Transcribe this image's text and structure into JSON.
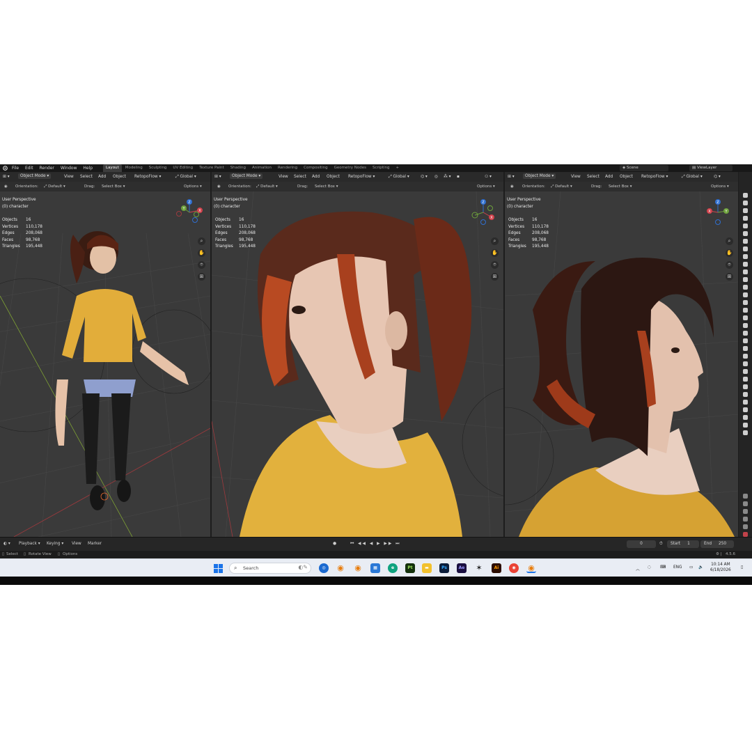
{
  "menu": [
    "File",
    "Edit",
    "Render",
    "Window",
    "Help"
  ],
  "workspace_tabs": [
    "Layout",
    "Modeling",
    "Sculpting",
    "UV Editing",
    "Texture Paint",
    "Shading",
    "Animation",
    "Rendering",
    "Compositing",
    "Geometry Nodes",
    "Scripting"
  ],
  "active_tab": "Layout",
  "scene": {
    "scene_label": "Scene",
    "view_layer_label": "ViewLayer"
  },
  "viewport_header": {
    "mode": "Object Mode",
    "menus": [
      "View",
      "Select",
      "Add",
      "Object"
    ],
    "addon": "RetopoFlow",
    "transform_orientation": "Global",
    "orientation_label": "Orientation:",
    "orientation_value": "Default",
    "drag_label": "Drag:",
    "drag_value": "Select Box",
    "options": "Options"
  },
  "viewport_info": {
    "perspective": "User Perspective",
    "collection": "(0) character",
    "stats": [
      {
        "label": "Objects",
        "value": "16"
      },
      {
        "label": "Vertices",
        "value": "110,178"
      },
      {
        "label": "Edges",
        "value": "208,068"
      },
      {
        "label": "Faces",
        "value": "98,768"
      },
      {
        "label": "Triangles",
        "value": "195,448"
      }
    ]
  },
  "gizmo_axes": {
    "x": "X",
    "y": "Y",
    "z": "Z"
  },
  "timeline": {
    "menus": [
      "Playback",
      "Keying",
      "View",
      "Marker"
    ],
    "current_frame": "0",
    "start_label": "Start",
    "start_value": "1",
    "end_label": "End",
    "end_value": "250"
  },
  "statusbar": {
    "select": "Select",
    "rotate": "Rotate View",
    "options": "Options",
    "version": "4.5.6"
  },
  "taskbar": {
    "search_placeholder": "Search",
    "apps": [
      {
        "name": "windows-start-icon",
        "label": "",
        "color": "#1a73e8"
      },
      {
        "name": "blender-app-icon",
        "label": "",
        "color": "#e87d0d"
      },
      {
        "name": "photoshop-app-icon",
        "label": "Ps",
        "color": "#0b1d3a"
      },
      {
        "name": "after-effects-app-icon",
        "label": "Ae",
        "color": "#1a0f40"
      },
      {
        "name": "illustrator-app-icon",
        "label": "Ai",
        "color": "#2b0d00"
      },
      {
        "name": "pt-app-icon",
        "label": "Pt",
        "color": "#14310c"
      }
    ],
    "language": "ENG",
    "time": "10:14 AM",
    "date": "6/18/2026"
  },
  "colors": {
    "accent": "#4772b3",
    "sweater": "#e4b64a",
    "hair": "#6b2a1a"
  }
}
